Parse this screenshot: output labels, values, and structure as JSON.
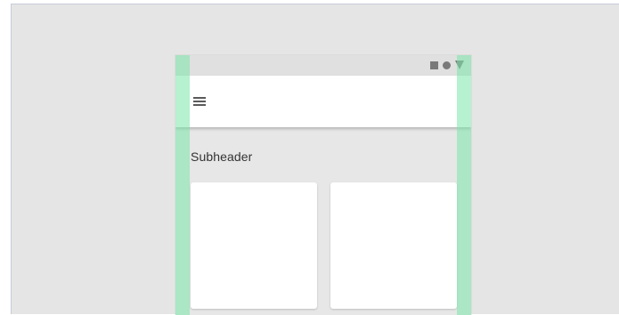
{
  "colors": {
    "canvas_background": "#e5e5e5",
    "keyline_overlay": "#7ae6aa",
    "app_bar": "#ffffff",
    "status_icon": "#7a7a7a"
  },
  "status_bar": {
    "icons": [
      "square-icon",
      "circle-icon",
      "triangle-icon"
    ]
  },
  "app_bar": {
    "menu_icon": "hamburger-menu-icon"
  },
  "content": {
    "subheader": "Subheader",
    "cards": [
      {
        "name": "card-1"
      },
      {
        "name": "card-2"
      }
    ]
  }
}
